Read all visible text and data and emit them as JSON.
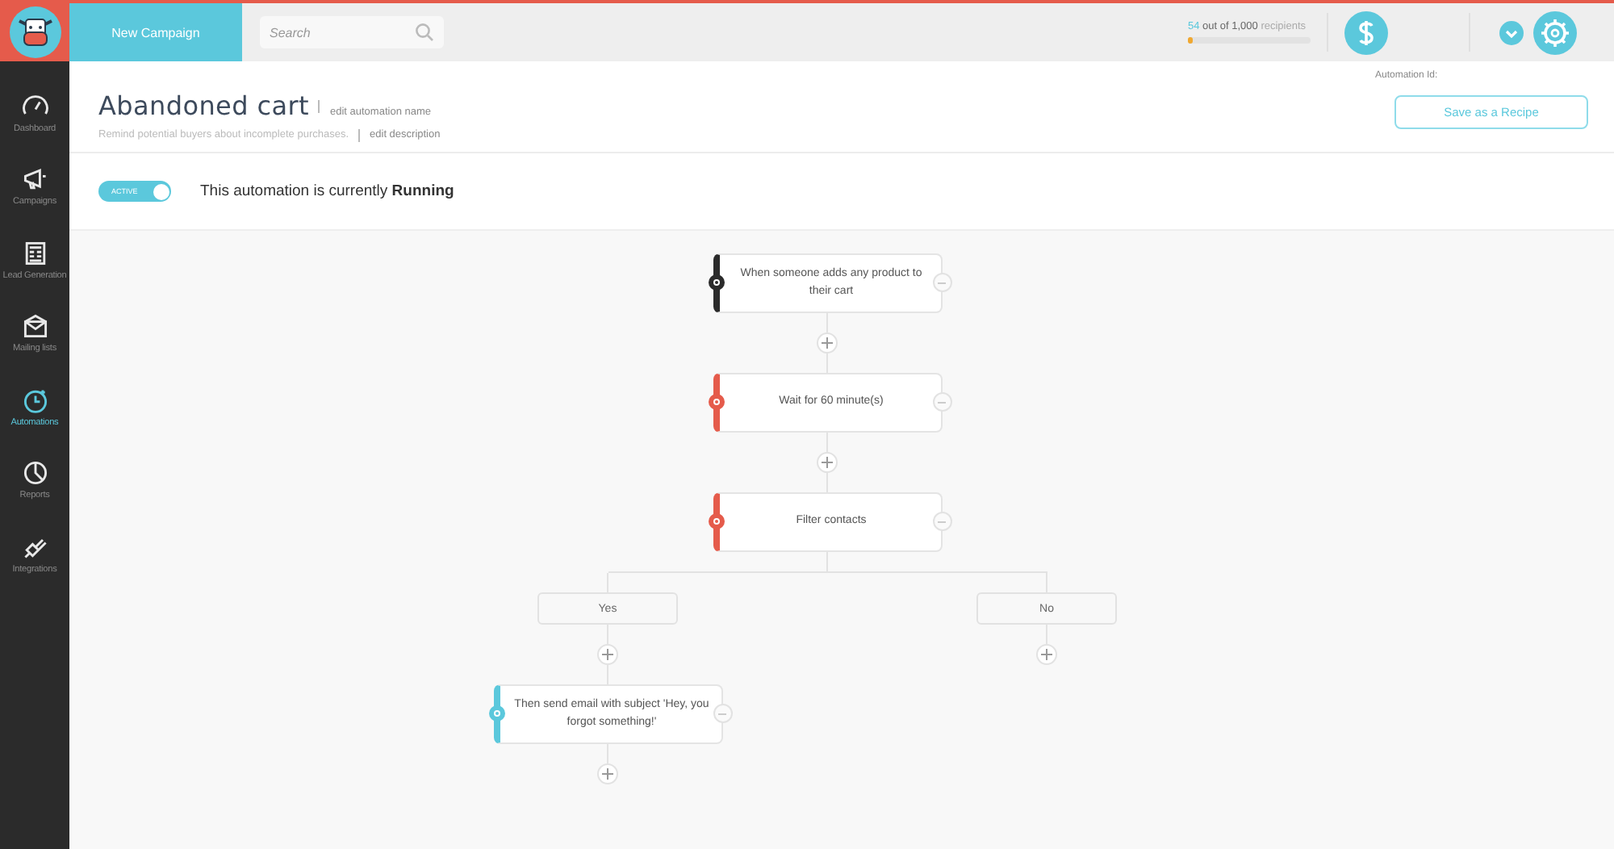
{
  "top_bar": {
    "new_campaign": "New Campaign",
    "search": {
      "placeholder": "Search"
    },
    "usage": {
      "used": "54",
      "text": "out of 1,000",
      "unit": "recipients",
      "level": 0.04
    }
  },
  "sidebar": {
    "items": [
      {
        "label": "Dashboard",
        "kind": "gauge",
        "selected": false
      },
      {
        "label": "Campaigns",
        "kind": "megaphone",
        "selected": false
      },
      {
        "label": "Lead Generation",
        "kind": "form",
        "selected": false
      },
      {
        "label": "Mailing lists",
        "kind": "envelope",
        "selected": false
      },
      {
        "label": "Automations",
        "kind": "clock",
        "selected": true
      },
      {
        "label": "Reports",
        "kind": "pie",
        "selected": false
      },
      {
        "label": "Integrations",
        "kind": "plug",
        "selected": false
      }
    ]
  },
  "header": {
    "title": "Abandoned cart",
    "edit_name": "edit automation name",
    "description": "Remind potential buyers about incomplete purchases.",
    "edit_description": "edit description",
    "automation_id_label": "Automation Id:",
    "save_button": "Save as a Recipe"
  },
  "status": {
    "toggle": {
      "label": "ACTIVE",
      "on": true
    },
    "text": "This automation is currently **Running**"
  },
  "flow": {
    "steps": [
      {
        "kind": "trigger",
        "text": "When someone adds any product to their cart"
      },
      {
        "kind": "delay",
        "text": "Wait for 60 minute(s)"
      },
      {
        "kind": "filter",
        "text": "Filter contacts"
      }
    ],
    "branches": [
      {
        "label": "Yes",
        "steps": [
          {
            "kind": "action",
            "text": "Then send email with subject 'Hey, you forgot something!'"
          }
        ]
      },
      {
        "label": "No"
      }
    ]
  }
}
